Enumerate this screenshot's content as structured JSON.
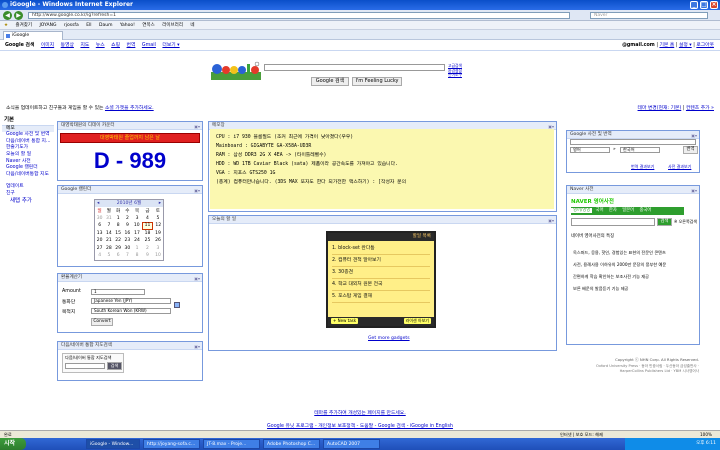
{
  "browser": {
    "title": "iGoogle - Windows Internet Explorer",
    "address": "http://www.google.co.kr/ig?refresh=1",
    "search_placeholder": "Naver",
    "favorites_label": "즐겨찾기",
    "favorites": [
      "JOYANG",
      "rjossfa",
      "Ell",
      "Daum",
      "Yahoo!",
      "연목스",
      "라이브러리",
      "네"
    ],
    "tab_label": "iGoogle"
  },
  "gbar": {
    "current": "Google 검색",
    "links": [
      "이미지",
      "동영상",
      "지도",
      "뉴스",
      "쇼핑",
      "번역",
      "Gmail",
      "더보기 ▾"
    ],
    "account": "@gmail.com",
    "right_links": [
      "기본 홈",
      "설정 ▾",
      "로그아웃"
    ]
  },
  "search": {
    "button_search": "Google 검색",
    "button_lucky": "I'm Feeling Lucky",
    "adv_lines": [
      "고급검색",
      "환경설정",
      "언어도구"
    ]
  },
  "promo": {
    "text": "소식을 업데이트하고 친구들과 게임을 할 수 있는",
    "link": "소셜 가젯을 추가하세요."
  },
  "top_right": {
    "theme": "테마 변경(현재: 기본)",
    "add": "컨텐츠 추가 »"
  },
  "sidebar": {
    "header": "기본",
    "items": [
      "메모",
      "Google 사전 및 번역",
      "다음/네이버 통합 지...",
      "한줄기도가",
      "오늘의 할 일",
      "Naver 사전",
      "Google 캘린더",
      "다음/네이버통합 지도",
      "",
      "업데이트",
      "친구"
    ],
    "new_tab": "새탭 추가"
  },
  "dday": {
    "title": "대영박태원의 디데이 카운터",
    "banner": "대영박태원 졸업까지 남은 날",
    "value": "D - 989"
  },
  "calendar": {
    "title": "Google 캘린더",
    "month": "2010년 6월",
    "days": [
      "일",
      "월",
      "화",
      "수",
      "목",
      "금",
      "토"
    ],
    "weeks": [
      [
        "30",
        "31",
        "1",
        "2",
        "3",
        "4",
        "5"
      ],
      [
        "6",
        "7",
        "8",
        "9",
        "10",
        "11",
        "12"
      ],
      [
        "13",
        "14",
        "15",
        "16",
        "17",
        "18",
        "19"
      ],
      [
        "20",
        "21",
        "22",
        "23",
        "24",
        "25",
        "26"
      ],
      [
        "27",
        "28",
        "29",
        "30",
        "1",
        "2",
        "3"
      ],
      [
        "4",
        "5",
        "6",
        "7",
        "8",
        "9",
        "10"
      ]
    ],
    "today": "11"
  },
  "memo": {
    "title": "메모장",
    "lines": [
      "CPU : i7 930 블룸필드 (조커 최근에 가격이 낮아졌다(우우)",
      "Mainboard : GIGABYTE GA-X58A-UD3R",
      "RAM : 삼성 DDR3 2G X 4EA -> (타이틀레벨수)",
      "HDD : WD 1TB Caviar Black (sata) 제품이라 공간속도를 가져야고 있습니다.",
      "VGA : 지포스 GTS250 1G",
      "(총계) 컴퓨터만나습니다. (3DS MAX 또자도 한다 되가전한 맥스하기) : [작성자 문의"
    ]
  },
  "todo": {
    "title": "오늘의 할 일",
    "inner_title": "할일 목록",
    "items": [
      "1. block-set 완다툼",
      "2. 컴퓨터 견적 알아보기",
      "3. 30층견",
      "4. 학교 대외처 원본 전국",
      "5. 포스탑 게임 결재"
    ],
    "new_task": "+ New task",
    "share": "라이센 아보기",
    "more": "Get more gadgets"
  },
  "currency": {
    "title": "환율계산기",
    "amount_label": "Amount",
    "amount": "1",
    "from_label": "통화단",
    "from": "Japanese Yen (JPY)",
    "to_label": "목적지",
    "to": "South Korean Won (KRW)",
    "convert": "Convert"
  },
  "mapsearch": {
    "title": "다음/네이버 통합 지도검색",
    "label": "다음/네이버 통합 지도검색",
    "button": "검색"
  },
  "dict": {
    "title": "Google 사전 및 번역",
    "from": "영어",
    "to": "한국어",
    "button": "번역",
    "links": [
      "번역 결과보기",
      "사전 결과보기"
    ]
  },
  "naver": {
    "title": "Naver 사전",
    "logo": "NAVER 영어사전",
    "tabs": [
      "영어/영영",
      "국어",
      "한자",
      "일본어",
      "중국어"
    ],
    "search_button": "검색",
    "hint": "※ 오른쪽검색",
    "daily": "네이버 영어사전의 특징",
    "news": [
      "옥스퍼드, 응용, 핫인, 경험있는 표현의 전문인 콘텐츠",
      "사전, 용례사용 이하유의 2000만 문장의 풍부한 예문",
      "간편하게 학습 확인하는 보조사전 기능 재공",
      "보른 배운의 발음듣기 기능 제공"
    ],
    "copy": "Copyright ⓒ NHN Corp. All Rights Reserved.",
    "credits": "Oxford University Press · 동아 민중서림 · 두산동아 금성출판사 · HarperCollins Publishers Ltd · YBM 시사영어사"
  },
  "footer": {
    "line1": "테마를 추가하여 개성있는 페이지를 만드세요.",
    "line2": "Google 유닛 프로그램 - 개인정보 보호정책 - 도움말 - Google 검색 - iGoogle in English"
  },
  "status": {
    "left": "완료",
    "zone": "인터넷 | 보호 모드: 해제",
    "zoom": "100%"
  },
  "taskbar": {
    "start": "시작",
    "tasks": [
      "iGoogle - Window...",
      "http://joyang-sofa.c...",
      "JT-8.max - Proje...",
      "Adobe Photoshop C...",
      "AutoCAD 2007"
    ],
    "clock": "오후 6:11"
  }
}
